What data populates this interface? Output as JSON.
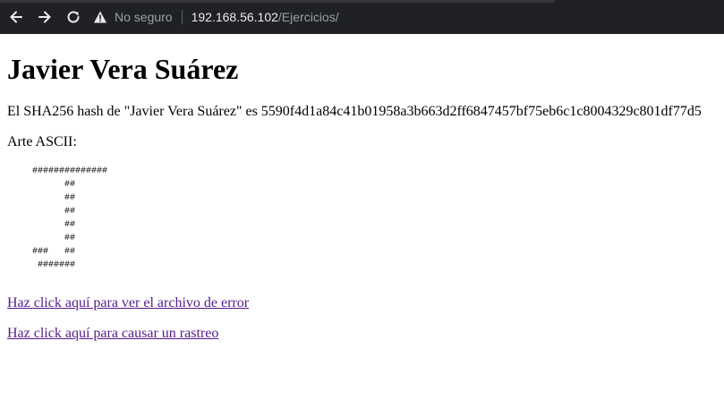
{
  "browser": {
    "security_label": "No seguro",
    "url_host": "192.168.56.102",
    "url_path": "/Ejercicios/"
  },
  "page": {
    "title": "Javier Vera Suárez",
    "hash_text": "El SHA256 hash de \"Javier Vera Suárez\" es 5590f4d1a84c41b01958a3b663d2ff6847457bf75eb6c1c8004329c801df77d5",
    "ascii_label": "Arte ASCII:",
    "ascii_art": "##############\n      ##\n      ##\n      ##\n      ##\n      ##\n###   ##\n #######",
    "link_error": "Haz click aquí para ver el archivo de error",
    "link_trace": "Haz click aquí para causar un rastreo"
  }
}
